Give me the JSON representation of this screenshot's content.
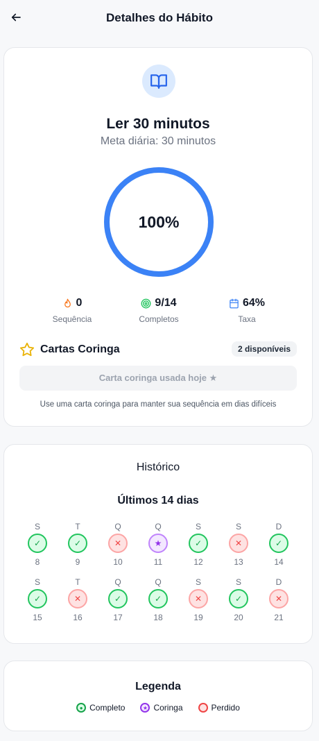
{
  "header": {
    "title": "Detalhes do Hábito",
    "back_icon": "arrow-left-icon"
  },
  "habit": {
    "icon": "book-open-icon",
    "name": "Ler 30 minutos",
    "goal": "Meta diária: 30 minutos",
    "progress_percent": 100,
    "progress_label": "100%",
    "accent_color": "#3b82f6"
  },
  "stats": [
    {
      "icon": "flame-icon",
      "value": "0",
      "label": "Sequência",
      "color": "#f97316"
    },
    {
      "icon": "target-icon",
      "value": "9/14",
      "label": "Completos",
      "color": "#22c55e"
    },
    {
      "icon": "calendar-icon",
      "value": "64%",
      "label": "Taxa",
      "color": "#3b82f6"
    }
  ],
  "wildcards": {
    "icon": "star-icon",
    "title": "Cartas Coringa",
    "badge": "2 disponíveis",
    "button_label": "Carta coringa usada hoje ★",
    "hint": "Use uma carta coringa para manter sua sequência em dias difíceis"
  },
  "history": {
    "title": "Histórico",
    "subtitle": "Últimos 14 dias",
    "days": [
      {
        "letter": "S",
        "number": "8",
        "status": "complete"
      },
      {
        "letter": "T",
        "number": "9",
        "status": "complete"
      },
      {
        "letter": "Q",
        "number": "10",
        "status": "missed"
      },
      {
        "letter": "Q",
        "number": "11",
        "status": "wild"
      },
      {
        "letter": "S",
        "number": "12",
        "status": "complete"
      },
      {
        "letter": "S",
        "number": "13",
        "status": "missed"
      },
      {
        "letter": "D",
        "number": "14",
        "status": "complete"
      },
      {
        "letter": "S",
        "number": "15",
        "status": "complete"
      },
      {
        "letter": "T",
        "number": "16",
        "status": "missed"
      },
      {
        "letter": "Q",
        "number": "17",
        "status": "complete"
      },
      {
        "letter": "Q",
        "number": "18",
        "status": "complete"
      },
      {
        "letter": "S",
        "number": "19",
        "status": "missed"
      },
      {
        "letter": "S",
        "number": "20",
        "status": "complete"
      },
      {
        "letter": "D",
        "number": "21",
        "status": "missed"
      }
    ],
    "status_symbols": {
      "complete": "✓",
      "missed": "✕",
      "wild": "★"
    }
  },
  "legend": {
    "title": "Legenda",
    "items": [
      {
        "label": "Completo",
        "status": "complete"
      },
      {
        "label": "Coringa",
        "status": "wild"
      },
      {
        "label": "Perdido",
        "status": "missed"
      }
    ]
  }
}
